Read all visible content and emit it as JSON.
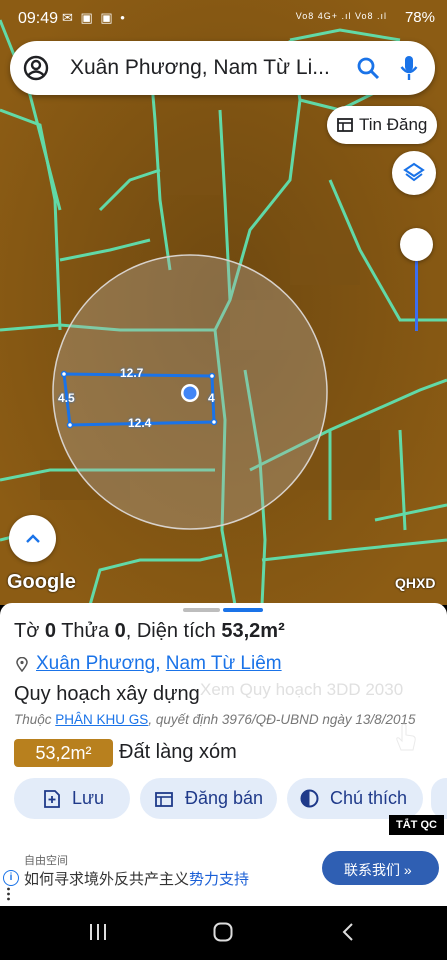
{
  "status_bar": {
    "time": "09:49",
    "notification_icons": "✉ ▣ ▣ •",
    "signal_text": "Vo8 4G+ .ıl Vo8 .ıl",
    "battery": "78%"
  },
  "search": {
    "query": "Xuân Phương, Nam Từ Li..."
  },
  "map": {
    "tin_dang_label": "Tin Đăng",
    "dimensions": {
      "top": "12.7",
      "bottom": "12.4",
      "left": "4.5",
      "right": "4"
    },
    "attribution": "Google",
    "layer_code": "QHXD",
    "colors": {
      "map_bg": "#8a5a12",
      "parcel_lines": "#5ee8b8",
      "selected_outline": "#1a73e8"
    }
  },
  "sheet": {
    "title_prefix_1": "Tờ ",
    "sheet_no": "0",
    "title_prefix_2": " Thửa ",
    "parcel_no": "0",
    "title_prefix_3": ", Diện tích ",
    "area": "53,2m²",
    "address_ward": "Xuân Phương",
    "address_sep": ", ",
    "address_district": "Nam Từ Liêm",
    "plan_title": "Quy hoạch xây dựng",
    "plan_ghost": "Xem Quy hoạch 3DD 2030",
    "plan_info_prefix": "Thuộc ",
    "plan_info_link": "PHÂN KHU GS",
    "plan_info_suffix": ", quyết định 3976/QĐ-UBND ngày 13/8/2015",
    "area_badge": "53,2m²",
    "land_type": "Đất làng xóm",
    "buttons": {
      "save": "Lưu",
      "post": "Đăng bán",
      "legend": "Chú thích"
    },
    "ad_close": "TẮT QC"
  },
  "ad": {
    "source": "自由空间",
    "text_plain": "如何寻求境外反共产主义",
    "text_highlight": "势力支持",
    "cta": "联系我们 »"
  }
}
